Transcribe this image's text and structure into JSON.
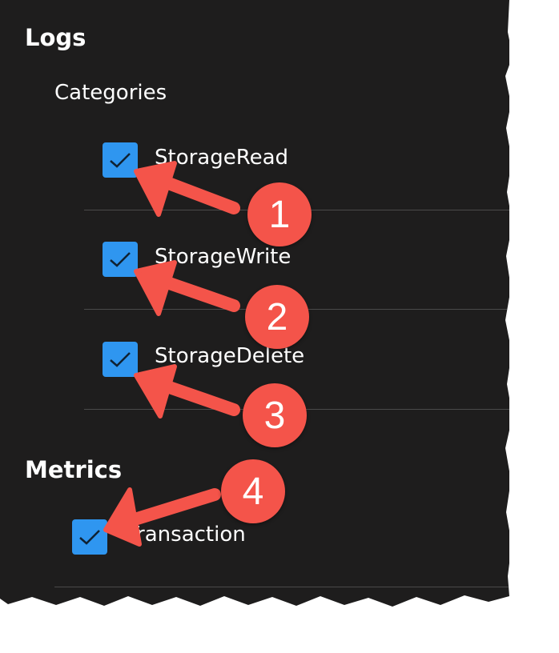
{
  "logs": {
    "heading": "Logs",
    "categories_label": "Categories",
    "items": [
      {
        "label": "StorageRead",
        "checked": true
      },
      {
        "label": "StorageWrite",
        "checked": true
      },
      {
        "label": "StorageDelete",
        "checked": true
      }
    ]
  },
  "metrics": {
    "heading": "Metrics",
    "items": [
      {
        "label": "Transaction",
        "checked": true
      }
    ]
  },
  "callouts": [
    "1",
    "2",
    "3",
    "4"
  ],
  "colors": {
    "panel_bg": "#1e1d1d",
    "checkbox": "#2f96f0",
    "callout": "#f4544a"
  }
}
